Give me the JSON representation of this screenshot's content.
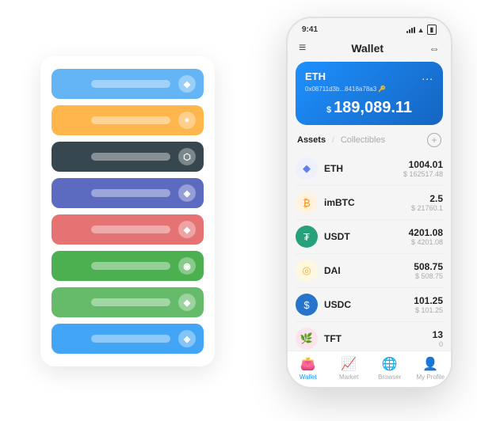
{
  "scene": {
    "card_stack": {
      "items": [
        {
          "color": "#64b5f6",
          "icon": "◆"
        },
        {
          "color": "#ffb74d",
          "icon": "●"
        },
        {
          "color": "#37474f",
          "icon": "⬡"
        },
        {
          "color": "#5c6bc0",
          "icon": "◈"
        },
        {
          "color": "#e57373",
          "icon": "◆"
        },
        {
          "color": "#4caf50",
          "icon": "◉"
        },
        {
          "color": "#66bb6a",
          "icon": "◆"
        },
        {
          "color": "#42a5f5",
          "icon": "◈"
        }
      ]
    },
    "phone": {
      "status_bar": {
        "time": "9:41",
        "signal_label": "signal",
        "wifi_label": "wifi",
        "battery_label": "battery"
      },
      "header": {
        "menu_icon": "≡",
        "title": "Wallet",
        "scan_icon": "⇔"
      },
      "eth_card": {
        "name": "ETH",
        "dots": "...",
        "address": "0x08711d3b...8418a78a3 🔑",
        "currency_symbol": "$",
        "balance": "189,089.11"
      },
      "tabs": {
        "assets_label": "Assets",
        "separator": "/",
        "collectibles_label": "Collectibles",
        "add_icon": "+"
      },
      "assets": [
        {
          "name": "ETH",
          "icon_char": "◆",
          "icon_color": "#627eea",
          "bg_color": "#eef0fc",
          "balance": "1004.01",
          "usd": "$ 162517.48"
        },
        {
          "name": "imBTC",
          "icon_char": "₿",
          "icon_color": "#f7931a",
          "bg_color": "#fff3e0",
          "balance": "2.5",
          "usd": "$ 21760.1"
        },
        {
          "name": "USDT",
          "icon_char": "₮",
          "icon_color": "#ffffff",
          "bg_color": "#26a17b",
          "balance": "4201.08",
          "usd": "$ 4201.08"
        },
        {
          "name": "DAI",
          "icon_char": "◎",
          "icon_color": "#f5ac37",
          "bg_color": "#fff8e1",
          "balance": "508.75",
          "usd": "$ 508.75"
        },
        {
          "name": "USDC",
          "icon_char": "$",
          "icon_color": "#ffffff",
          "bg_color": "#2775ca",
          "balance": "101.25",
          "usd": "$ 101.25"
        },
        {
          "name": "TFT",
          "icon_char": "🌿",
          "icon_color": "#e91e8c",
          "bg_color": "#fce4ec",
          "balance": "13",
          "usd": "0"
        }
      ],
      "bottom_nav": [
        {
          "icon": "👛",
          "label": "Wallet",
          "active": true
        },
        {
          "icon": "📈",
          "label": "Market",
          "active": false
        },
        {
          "icon": "🌐",
          "label": "Browser",
          "active": false
        },
        {
          "icon": "👤",
          "label": "My Profile",
          "active": false
        }
      ]
    }
  }
}
